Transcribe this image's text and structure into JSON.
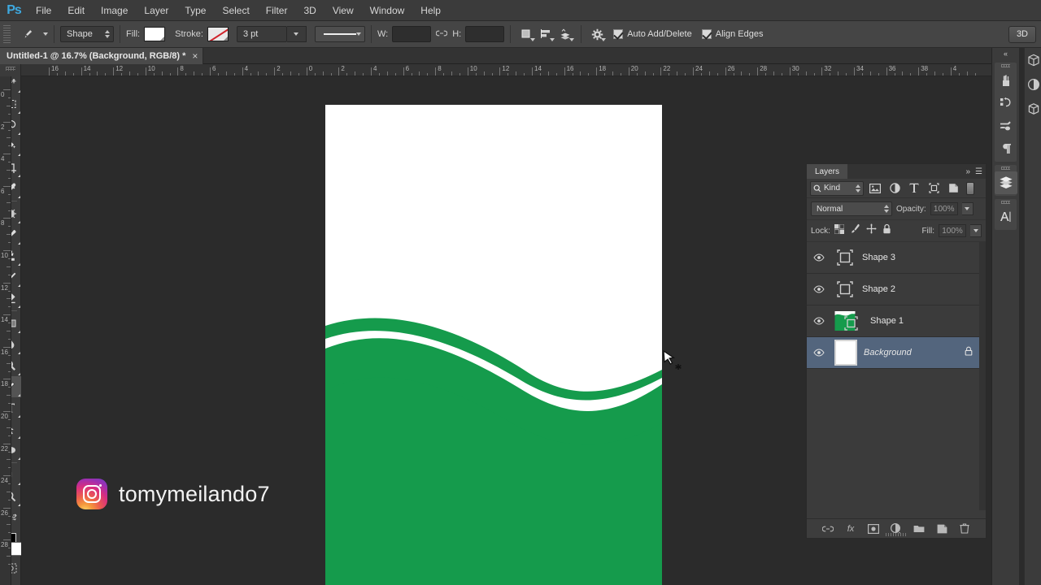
{
  "app": {
    "name": "Adobe Photoshop",
    "logo": "Ps"
  },
  "menubar": {
    "items": [
      "File",
      "Edit",
      "Image",
      "Layer",
      "Type",
      "Select",
      "Filter",
      "3D",
      "View",
      "Window",
      "Help"
    ]
  },
  "options_bar": {
    "tool_icon": "pen-tool-icon",
    "mode_value": "Shape",
    "fill_label": "Fill:",
    "fill_color": "#ffffff",
    "stroke_label": "Stroke:",
    "stroke_value": "none",
    "stroke_slash_color": "#d0232b",
    "weight_value": "3 pt",
    "width_label": "W:",
    "width_value": "",
    "height_label": "H:",
    "height_value": "",
    "link_icon": "link-icon",
    "path_op_icon": "path-operations-icon",
    "path_align_icon": "path-alignment-icon",
    "path_arrange_icon": "path-arrangement-icon",
    "gear_icon": "gear-icon",
    "auto_add_delete_label": "Auto Add/Delete",
    "auto_add_delete_checked": true,
    "align_edges_label": "Align Edges",
    "align_edges_checked": true,
    "workspace_label": "3D"
  },
  "document_tab": {
    "title": "Untitled-1 @ 16.7% (Background, RGB/8) *",
    "close_icon": "close-icon"
  },
  "toolbar": {
    "tools": [
      {
        "name": "move-tool",
        "active": false
      },
      {
        "name": "rectangular-marquee-tool",
        "active": false
      },
      {
        "name": "lasso-tool",
        "active": false
      },
      {
        "name": "magic-wand-tool",
        "active": false
      },
      {
        "name": "crop-tool",
        "active": false
      },
      {
        "name": "eyedropper-tool",
        "active": false
      },
      {
        "name": "spot-healing-brush-tool",
        "active": false
      },
      {
        "name": "brush-tool",
        "active": false
      },
      {
        "name": "clone-stamp-tool",
        "active": false
      },
      {
        "name": "history-brush-tool",
        "active": false
      },
      {
        "name": "eraser-tool",
        "active": false
      },
      {
        "name": "gradient-tool",
        "active": false
      },
      {
        "name": "blur-tool",
        "active": false
      },
      {
        "name": "dodge-tool",
        "active": false
      },
      {
        "name": "pen-tool",
        "active": true
      },
      {
        "name": "horizontal-type-tool",
        "active": false
      },
      {
        "name": "path-selection-tool",
        "active": false
      },
      {
        "name": "ellipse-tool",
        "active": false
      },
      {
        "name": "hand-tool",
        "active": false
      },
      {
        "name": "zoom-tool",
        "active": false
      }
    ],
    "foreground_color": "#000000",
    "background_color": "#ffffff"
  },
  "rulers": {
    "horizontal_ticks": [
      "16",
      "14",
      "12",
      "10",
      "8",
      "6",
      "4",
      "2",
      "0",
      "2",
      "4",
      "6",
      "8",
      "10",
      "12",
      "14",
      "16",
      "18",
      "20",
      "22",
      "24",
      "26",
      "28",
      "30",
      "32",
      "34",
      "36",
      "38",
      "4"
    ],
    "vertical_ticks": [
      "0",
      "2",
      "4",
      "6",
      "8",
      "10",
      "12",
      "14",
      "16",
      "18",
      "20",
      "22",
      "24",
      "26",
      "28"
    ],
    "unit": "cm"
  },
  "canvas": {
    "zoom": "16.7%",
    "background_color": "#ffffff",
    "shape_color": "#159b4c",
    "cursor": "pen-tool-cursor-new-path"
  },
  "watermark": {
    "icon": "instagram-icon",
    "handle": "tomymeilando7"
  },
  "layers_panel": {
    "tab_label": "Layers",
    "expand_icon": "double-chevron-right-icon",
    "menu_icon": "panel-menu-icon",
    "filter": {
      "search_icon": "search-icon",
      "kind_label": "Kind",
      "icons": [
        "pixel-layer-filter-icon",
        "adjustment-layer-filter-icon",
        "type-layer-filter-icon",
        "shape-layer-filter-icon",
        "smart-object-filter-icon"
      ],
      "toggle": "filter-toggle-switch"
    },
    "blend_mode": "Normal",
    "opacity_label": "Opacity:",
    "opacity_value": "100%",
    "lock_label": "Lock:",
    "lock_icons": [
      "lock-transparent-pixels-icon",
      "lock-image-pixels-icon",
      "lock-position-icon",
      "lock-all-icon"
    ],
    "fill_label": "Fill:",
    "fill_value": "100%",
    "layers": [
      {
        "name": "Shape 3",
        "visible": true,
        "thumb": "shape-vector-mask",
        "selected": false,
        "locked": false,
        "italic": false
      },
      {
        "name": "Shape 2",
        "visible": true,
        "thumb": "shape-vector-mask",
        "selected": false,
        "locked": false,
        "italic": false
      },
      {
        "name": "Shape 1",
        "visible": true,
        "thumb": "green-shape-thumbnail",
        "selected": false,
        "locked": false,
        "italic": false
      },
      {
        "name": "Background",
        "visible": true,
        "thumb": "white-background-thumbnail",
        "selected": true,
        "locked": true,
        "italic": true
      }
    ],
    "footer_icons": [
      "link-layers-icon",
      "layer-style-fx-icon",
      "add-layer-mask-icon",
      "new-adjustment-layer-icon",
      "new-group-icon",
      "new-layer-icon",
      "delete-layer-icon"
    ]
  },
  "right_dock": {
    "collapse_icon": "collapse-panels-icon",
    "groups": [
      {
        "icons": [
          "brush-presets-icon",
          "history-icon",
          "swatches-icon",
          "paragraph-icon"
        ]
      },
      {
        "icons": [
          "layers-panel-icon"
        ],
        "active_index": 0
      },
      {
        "icons": [
          "character-panel-icon"
        ]
      }
    ],
    "far_icons": [
      "3d-panel-icon",
      "adjustments-icon",
      "3d-secondary-icon"
    ]
  }
}
